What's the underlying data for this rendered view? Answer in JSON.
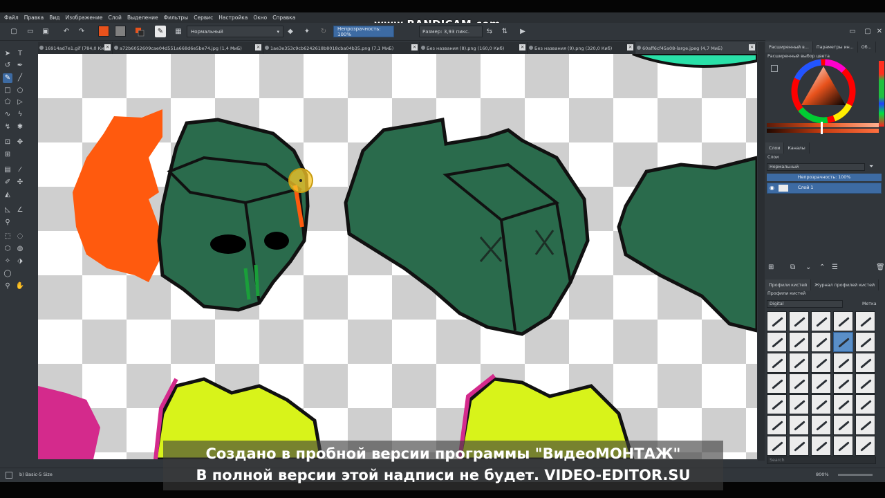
{
  "watermark_top": "www.BANDICAM.com",
  "menu": [
    "Файл",
    "Правка",
    "Вид",
    "Изображение",
    "Слой",
    "Выделение",
    "Фильтры",
    "Сервис",
    "Настройка",
    "Окно",
    "Справка"
  ],
  "toolbar": {
    "blend_mode": "Нормальный",
    "opacity_label": "Непрозрачность: 100%",
    "size_label": "Размер: 3,93 пикс."
  },
  "tabs": [
    "16914ad7e1.gif (784,0 Киб)",
    "a72b6052609cae04d551a668d6e5be74.jpg (1,4 МиБ)",
    "1ae3e353c9cb6242618b8018cba04b35.png (7,1 МиБ)",
    "Без названия (8).png (160,0 Киб)",
    "Без названия (9).png (320,0 Киб)",
    "60aff6cf45a08-large.jpeg (4,7 МиБ)"
  ],
  "dock": {
    "top_tabs": [
      "Расширенный в...",
      "Параметры ин...",
      "Об..."
    ],
    "color_selector_title": "Расширенный выбор цвета",
    "layers_tabs": [
      "Слои",
      "Каналы"
    ],
    "layers_title": "Слои",
    "layer_blend": "Нормальный",
    "layer_opacity": "Непрозрачность: 100%",
    "layer_name": "Слой 1",
    "brush_tabs": [
      "Профили кистей",
      "Журнал профилей кистей"
    ],
    "brush_title": "Профили кистей",
    "brush_tag": "Digital",
    "brush_tag_right": "Метка",
    "search_placeholder": "Search"
  },
  "status": {
    "brush_name": "b) Basic-5 Size",
    "zoom": "800%"
  },
  "watermark": {
    "line1": "Создано в пробной версии программы \"ВидеоМОНТАЖ\"",
    "line2": "В полной версии этой надписи не будет. VIDEO-EDITOR.SU"
  },
  "colors": {
    "fg_color": "#e8521c",
    "creature_green": "#2a6b4c",
    "orange_paint": "#ff5a0e",
    "lime": "#d8f31a",
    "magenta": "#d42a8c"
  }
}
